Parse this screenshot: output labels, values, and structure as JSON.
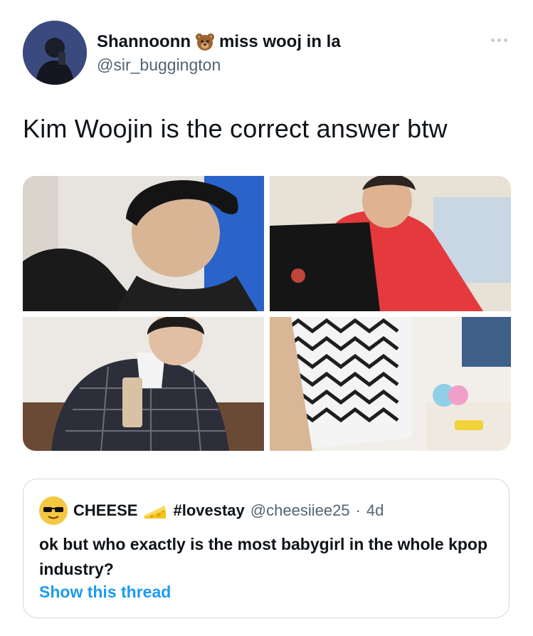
{
  "author": {
    "display_name": "Shannoonn",
    "display_name_suffix": "miss wooj in la",
    "name_emoji": "bear-face-emoji",
    "handle": "@sir_buggington"
  },
  "tweet": {
    "text": "Kim Woojin is the correct answer btw",
    "more_icon": "more-options-icon"
  },
  "media": {
    "photos": [
      "photo-1",
      "photo-2",
      "photo-3",
      "photo-4"
    ]
  },
  "quoted": {
    "display_name": "CHEESE",
    "name_emoji": "cheese-wedge-emoji",
    "hashtag": "#lovestay",
    "handle": "@cheesiiee25",
    "separator": "·",
    "age": "4d",
    "text": "ok but who exactly is the most babygirl in the whole kpop industry?",
    "show_thread": "Show this thread"
  },
  "colors": {
    "link": "#1d9bf0",
    "secondary_text": "#536471",
    "border": "#cfd9de"
  }
}
